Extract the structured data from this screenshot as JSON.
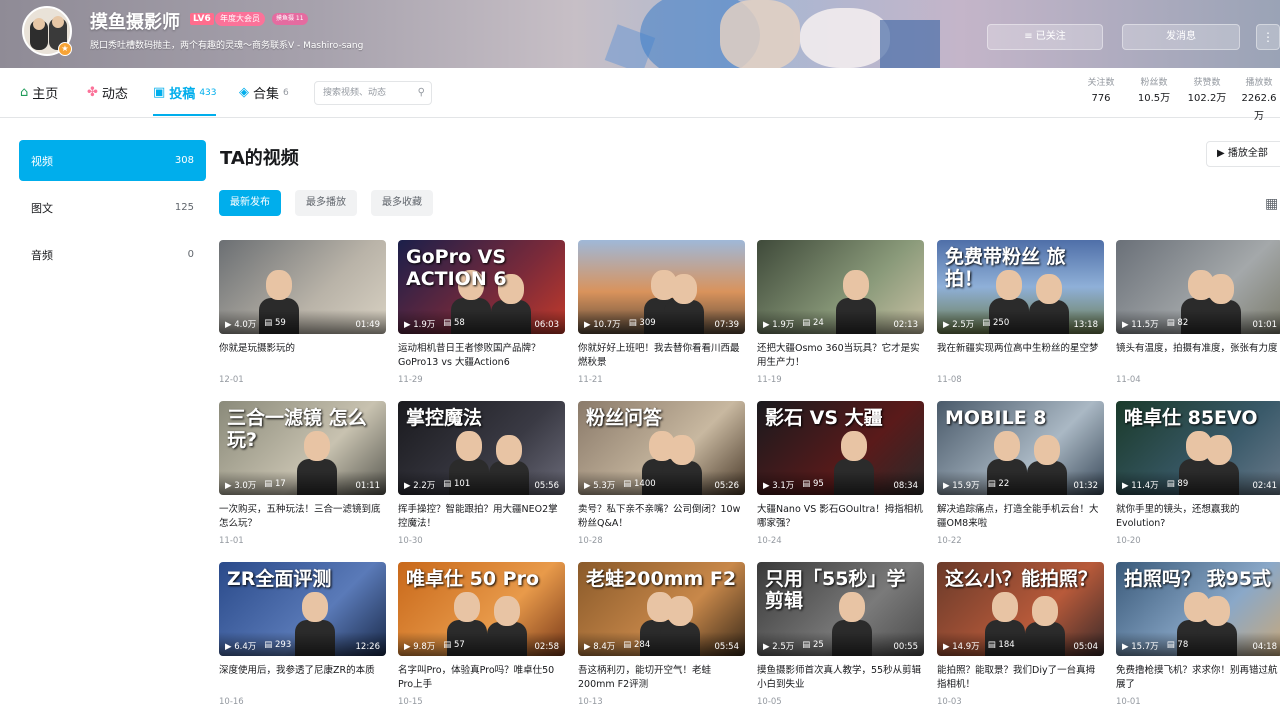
{
  "header": {
    "username": "摸鱼摄影师",
    "level": "LV6",
    "vip_badge": "年度大会员",
    "medal": "摸鱼摄 11",
    "signature": "脱口秀吐槽数码抛主，两个有趣的灵魂～商务联系V - Mashiro-sang",
    "follow_label": "≡ 已关注",
    "message_label": "发消息",
    "more_label": "⋮"
  },
  "nav": {
    "home": "主页",
    "dynamic": "动态",
    "uploads": "投稿",
    "uploads_count": "433",
    "collections": "合集",
    "collections_count": "6",
    "search_placeholder": "搜索视频、动态"
  },
  "stats": [
    {
      "label": "关注数",
      "value": "776"
    },
    {
      "label": "粉丝数",
      "value": "10.5万"
    },
    {
      "label": "获赞数",
      "value": "102.2万"
    },
    {
      "label": "播放数",
      "value": "2262.6万"
    }
  ],
  "sidebar": [
    {
      "label": "视频",
      "count": "308"
    },
    {
      "label": "图文",
      "count": "125"
    },
    {
      "label": "音频",
      "count": "0"
    }
  ],
  "main": {
    "title": "TA的视频",
    "play_all": "▶ 播放全部",
    "sort": [
      "最新发布",
      "最多播放",
      "最多收藏"
    ]
  },
  "videos": [
    {
      "views": "4.0万",
      "danmaku": "59",
      "duration": "01:49",
      "title": "你就是玩摄影玩的",
      "date": "12-01",
      "overlay": ""
    },
    {
      "views": "1.9万",
      "danmaku": "58",
      "duration": "06:03",
      "title": "运动相机昔日王者惨败国产品牌？GoPro13 vs 大疆Action6",
      "date": "11-29",
      "overlay": "GoPro VS ACTION 6"
    },
    {
      "views": "10.7万",
      "danmaku": "309",
      "duration": "07:39",
      "title": "你就好好上班吧！我去替你看看川西最燃秋景",
      "date": "11-21",
      "overlay": ""
    },
    {
      "views": "1.9万",
      "danmaku": "24",
      "duration": "02:13",
      "title": "还把大疆Osmo 360当玩具？它才是实用生产力！",
      "date": "11-19",
      "overlay": ""
    },
    {
      "views": "2.5万",
      "danmaku": "250",
      "duration": "13:18",
      "title": "我在新疆实现两位高中生粉丝的星空梦",
      "date": "11-08",
      "overlay": "免费带粉丝 旅拍！"
    },
    {
      "views": "11.5万",
      "danmaku": "82",
      "duration": "01:01",
      "title": "镜头有温度，拍摄有准度，张张有力度",
      "date": "11-04",
      "overlay": ""
    },
    {
      "views": "3.0万",
      "danmaku": "17",
      "duration": "01:11",
      "title": "一次购买，五种玩法！三合一滤镜到底怎么玩？",
      "date": "11-01",
      "overlay": "三合一滤镜 怎么玩?"
    },
    {
      "views": "2.2万",
      "danmaku": "101",
      "duration": "05:56",
      "title": "挥手操控？智能跟拍？用大疆NEO2掌控魔法！",
      "date": "10-30",
      "overlay": "掌控魔法"
    },
    {
      "views": "5.3万",
      "danmaku": "1400",
      "duration": "05:26",
      "title": "卖号？私下亲不亲嘴？公司倒闭？10w粉丝Q&A！",
      "date": "10-28",
      "overlay": "粉丝问答"
    },
    {
      "views": "3.1万",
      "danmaku": "95",
      "duration": "08:34",
      "title": "大疆Nano VS 影石GOultra！拇指相机哪家强？",
      "date": "10-24",
      "overlay": "影石 VS 大疆"
    },
    {
      "views": "15.9万",
      "danmaku": "22",
      "duration": "01:32",
      "title": "解决追踪痛点，打造全能手机云台！大疆OM8来啦",
      "date": "10-22",
      "overlay": "MOBILE 8"
    },
    {
      "views": "11.4万",
      "danmaku": "89",
      "duration": "02:41",
      "title": "就你手里的镜头，还想赢我的Evolution?",
      "date": "10-20",
      "overlay": "唯卓仕 85EVO"
    },
    {
      "views": "6.4万",
      "danmaku": "293",
      "duration": "12:26",
      "title": "深度使用后，我参透了尼康ZR的本质",
      "date": "10-16",
      "overlay": "ZR全面评测"
    },
    {
      "views": "9.8万",
      "danmaku": "57",
      "duration": "02:58",
      "title": "名字叫Pro，体验真Pro吗？唯卓仕50 Pro上手",
      "date": "10-15",
      "overlay": "唯卓仕 50 Pro"
    },
    {
      "views": "8.4万",
      "danmaku": "284",
      "duration": "05:54",
      "title": "吾这柄利刃，能切开空气！老蛙200mm F2评测",
      "date": "10-13",
      "overlay": "老蛙200mm F2"
    },
    {
      "views": "2.5万",
      "danmaku": "25",
      "duration": "00:55",
      "title": "摸鱼摄影师首次真人教学，55秒从剪辑小白到失业",
      "date": "10-05",
      "overlay": "只用「55秒」学剪辑"
    },
    {
      "views": "14.9万",
      "danmaku": "184",
      "duration": "05:04",
      "title": "能拍照？能取景？我们Diy了一台真拇指相机！",
      "date": "10-03",
      "overlay": "这么小？能拍照？"
    },
    {
      "views": "15.7万",
      "danmaku": "78",
      "duration": "04:18",
      "title": "免费撸枪摸飞机？求求你！别再错过航展了",
      "date": "10-01",
      "overlay": "拍照吗？ 我95式"
    }
  ],
  "colors": {
    "accent": "#00aeec",
    "text": "#18191c",
    "muted": "#9499a0"
  },
  "icons": {
    "home": "home-icon",
    "dynamic": "dynamic-icon",
    "uploads": "tv-icon",
    "collections": "layers-icon",
    "search": "search-icon",
    "grid": "grid-icon"
  }
}
